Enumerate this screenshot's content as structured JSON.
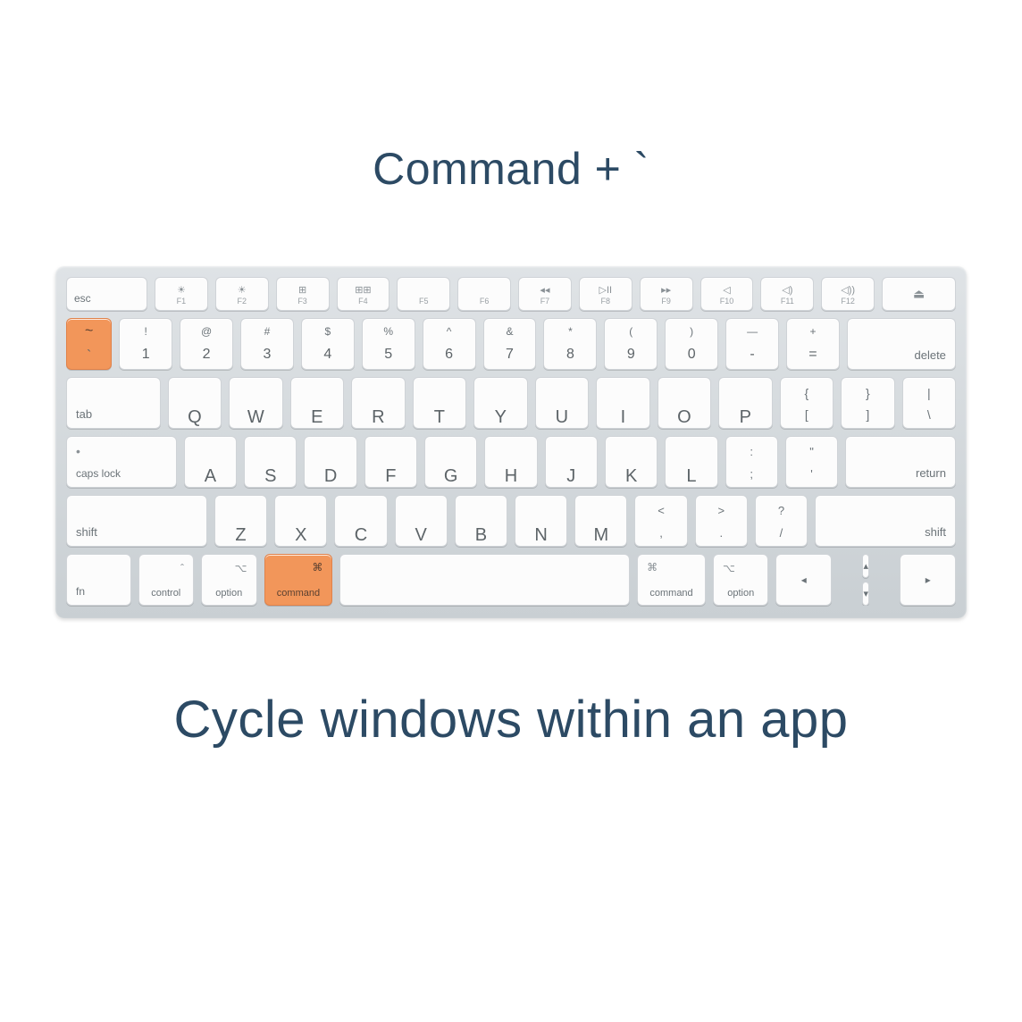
{
  "title": "Command + `",
  "caption": "Cycle windows within an app",
  "highlight_color": "#f2965a",
  "rows": {
    "fn": {
      "esc": "esc",
      "keys": [
        {
          "icon": "☀",
          "label": "F1"
        },
        {
          "icon": "☀",
          "label": "F2"
        },
        {
          "icon": "⊞",
          "label": "F3"
        },
        {
          "icon": "⊞⊞",
          "label": "F4"
        },
        {
          "icon": "",
          "label": "F5"
        },
        {
          "icon": "",
          "label": "F6"
        },
        {
          "icon": "◂◂",
          "label": "F7"
        },
        {
          "icon": "▷II",
          "label": "F8"
        },
        {
          "icon": "▸▸",
          "label": "F9"
        },
        {
          "icon": "◁",
          "label": "F10"
        },
        {
          "icon": "◁)",
          "label": "F11"
        },
        {
          "icon": "◁))",
          "label": "F12"
        }
      ],
      "eject": "⏏"
    },
    "num": {
      "tick": {
        "top": "~",
        "bot": "`",
        "highlight": true
      },
      "keys": [
        {
          "top": "!",
          "bot": "1"
        },
        {
          "top": "@",
          "bot": "2"
        },
        {
          "top": "#",
          "bot": "3"
        },
        {
          "top": "$",
          "bot": "4"
        },
        {
          "top": "%",
          "bot": "5"
        },
        {
          "top": "^",
          "bot": "6"
        },
        {
          "top": "&",
          "bot": "7"
        },
        {
          "top": "*",
          "bot": "8"
        },
        {
          "top": "(",
          "bot": "9"
        },
        {
          "top": ")",
          "bot": "0"
        },
        {
          "top": "—",
          "bot": "-"
        },
        {
          "top": "+",
          "bot": "="
        }
      ],
      "del": "delete"
    },
    "q": {
      "tab": "tab",
      "letters": [
        "Q",
        "W",
        "E",
        "R",
        "T",
        "Y",
        "U",
        "I",
        "O",
        "P"
      ],
      "br1": {
        "top": "{",
        "bot": "["
      },
      "br2": {
        "top": "}",
        "bot": "]"
      },
      "bs": {
        "top": "|",
        "bot": "\\"
      }
    },
    "a": {
      "caps": "caps lock",
      "letters": [
        "A",
        "S",
        "D",
        "F",
        "G",
        "H",
        "J",
        "K",
        "L"
      ],
      "p1": {
        "top": ":",
        "bot": ";"
      },
      "p2": {
        "top": "\"",
        "bot": "'"
      },
      "ret": "return"
    },
    "z": {
      "shiftL": "shift",
      "letters": [
        "Z",
        "X",
        "C",
        "V",
        "B",
        "N",
        "M"
      ],
      "p1": {
        "top": "<",
        "bot": ","
      },
      "p2": {
        "top": ">",
        "bot": "."
      },
      "p3": {
        "top": "?",
        "bot": "/"
      },
      "shiftR": "shift"
    },
    "mod": {
      "fn": "fn",
      "ctrl": {
        "icon": "ˆ",
        "label": "control"
      },
      "optL": {
        "icon": "⌥",
        "label": "option"
      },
      "cmdL": {
        "icon": "⌘",
        "label": "command",
        "highlight": true
      },
      "cmdR": {
        "icon": "⌘",
        "label": "command"
      },
      "optR": {
        "icon": "⌥",
        "label": "option"
      },
      "arrows": {
        "left": "◂",
        "up": "▴",
        "down": "▾",
        "right": "▸"
      }
    }
  }
}
